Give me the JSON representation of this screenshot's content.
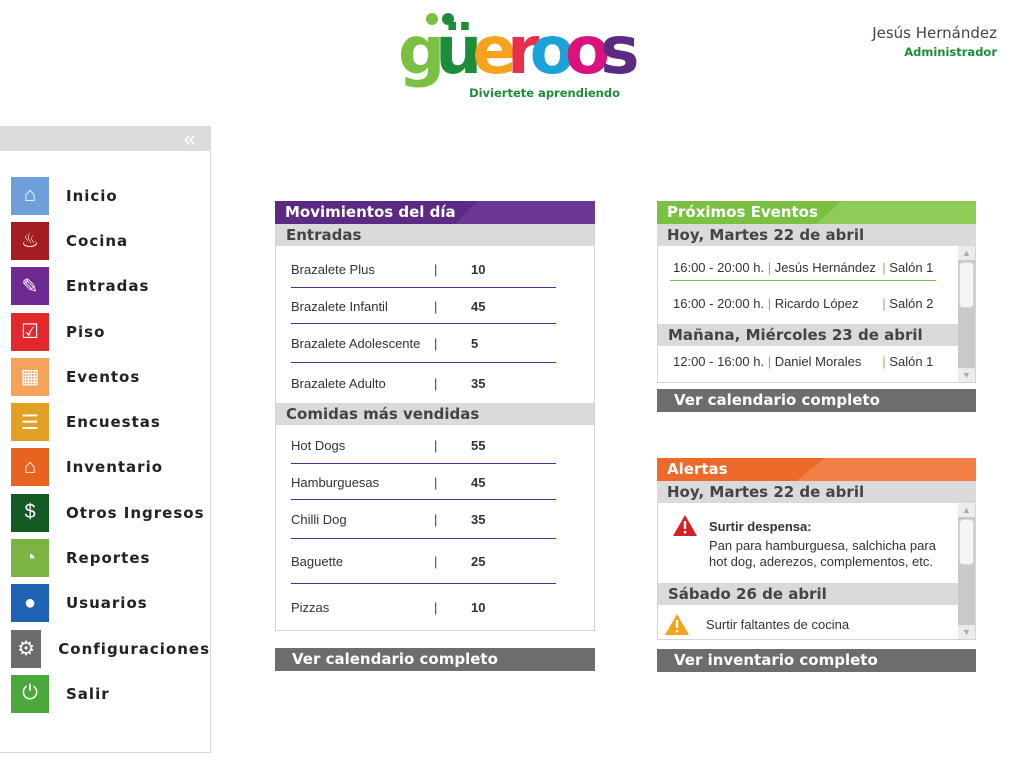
{
  "brand": {
    "logo_text": "güeroos",
    "tagline": "Diviertete aprendiendo",
    "letter_colors": [
      "#7ac143",
      "#1e8d3a",
      "#f6a21c",
      "#e8304d",
      "#1aa3d9",
      "#d9127d",
      "#5b2a82"
    ]
  },
  "user": {
    "name": "Jesús Hernández",
    "role": "Administrador"
  },
  "sidebar": {
    "collapse_icon": "«",
    "items": [
      {
        "label": "Inicio",
        "icon": "home-icon",
        "color": "#6f9fd8",
        "glyph": "⌂"
      },
      {
        "label": "Cocina",
        "icon": "chef-hat-icon",
        "color": "#a31d21",
        "glyph": "♨"
      },
      {
        "label": "Entradas",
        "icon": "ticket-icon",
        "color": "#6f2a91",
        "glyph": "✎"
      },
      {
        "label": "Piso",
        "icon": "checkbox-icon",
        "color": "#e4272b",
        "glyph": "☑"
      },
      {
        "label": "Eventos",
        "icon": "calendar-icon",
        "color": "#f5a25b",
        "glyph": "▦"
      },
      {
        "label": "Encuestas",
        "icon": "clipboard-icon",
        "color": "#e2a122",
        "glyph": "☰"
      },
      {
        "label": "Inventario",
        "icon": "warehouse-icon",
        "color": "#e76420",
        "glyph": "⌂"
      },
      {
        "label": "Otros Ingresos",
        "icon": "dollar-icon",
        "color": "#145a25",
        "glyph": "$"
      },
      {
        "label": "Reportes",
        "icon": "pie-chart-icon",
        "color": "#7cb342",
        "glyph": "◔"
      },
      {
        "label": "Usuarios",
        "icon": "user-icon",
        "color": "#1d62b3",
        "glyph": "●"
      },
      {
        "label": "Configuraciones",
        "icon": "gear-wrench-icon",
        "color": "#6b6b6b",
        "glyph": "⚙"
      },
      {
        "label": "Salir",
        "icon": "power-icon",
        "color": "#4ca83a",
        "glyph": "⏻"
      }
    ]
  },
  "movimientos": {
    "title": "Movimientos del día",
    "header_color": "#5b2a82",
    "entradas_title": "Entradas",
    "entradas": [
      {
        "name": "Brazalete Plus",
        "qty": "10"
      },
      {
        "name": "Brazalete Infantil",
        "qty": "45"
      },
      {
        "name": "Brazalete Adolescente",
        "qty": "5"
      },
      {
        "name": "Brazalete Adulto",
        "qty": "35"
      }
    ],
    "comidas_title": "Comidas más vendidas",
    "comidas": [
      {
        "name": "Hot Dogs",
        "qty": "55"
      },
      {
        "name": "Hamburguesas",
        "qty": "45"
      },
      {
        "name": "Chilli Dog",
        "qty": "35"
      },
      {
        "name": "Baguette",
        "qty": "25"
      },
      {
        "name": "Pizzas",
        "qty": "10"
      }
    ],
    "separator": "|",
    "button": "Ver calendario completo"
  },
  "eventos": {
    "title": "Próximos Eventos",
    "header_color": "#7ac143",
    "today": "Hoy, Martes 22 de abril",
    "today_rows": [
      {
        "time": "16:00 - 20:00 h.",
        "person": "Jesús Hernández",
        "room": "Salón 1"
      },
      {
        "time": "16:00 - 20:00 h.",
        "person": "Ricardo López",
        "room": "Salón 2"
      }
    ],
    "tomorrow": "Mañana, Miércoles 23 de abril",
    "tomorrow_rows": [
      {
        "time": "12:00 - 16:00 h.",
        "person": "Daniel Morales",
        "room": "Salón 1"
      }
    ],
    "button": "Ver calendario completo"
  },
  "alertas": {
    "title": "Alertas",
    "header_color": "#ee6a2b",
    "today": "Hoy, Martes 22 de abril",
    "alert1_title": "Surtir despensa:",
    "alert1_text": "Pan para hamburguesa, salchicha para hot dog, aderezos, complementos, etc.",
    "saturday": "Sábado 26 de abril",
    "alert2_text": "Surtir faltantes de cocina",
    "button": "Ver inventario completo"
  }
}
